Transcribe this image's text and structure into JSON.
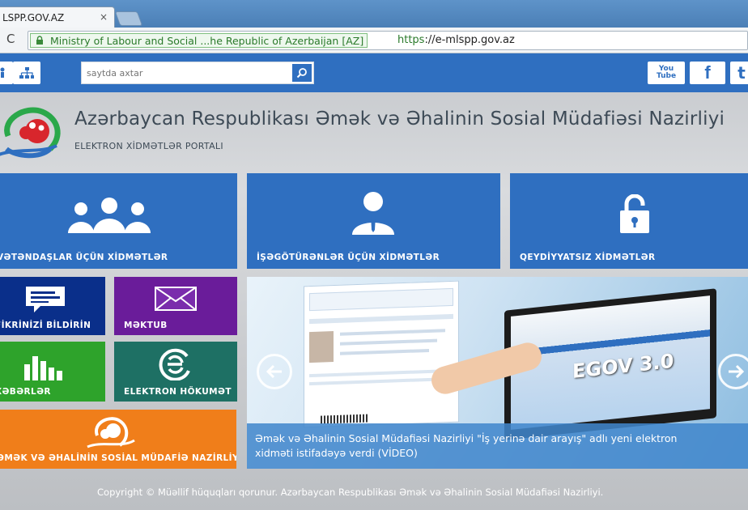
{
  "browser": {
    "tab_title": "LSPP.GOV.AZ",
    "tab_close": "×",
    "reload_icon": "C",
    "ev_label": "Ministry of Labour and Social ...he Republic of Azerbaijan [AZ]",
    "url_scheme": "https",
    "url_rest": "://e-mlspp.gov.az"
  },
  "topbar": {
    "search_placeholder": "saytda axtar",
    "social": [
      "You Tube",
      "f",
      "t"
    ]
  },
  "header": {
    "title": "Azərbaycan Respublikası Əmək və Əhalinin Sosial Müdafiəsi Nazirliyi",
    "subtitle": "ELEKTRON XİDMƏTLƏR PORTALI"
  },
  "tiles": {
    "citizens": "VƏTƏNDAŞLAR ÜÇÜN XİDMƏTLƏR",
    "employers": "İŞƏGÖTÜRƏNLƏR ÜÇÜN XİDMƏTLƏR",
    "unregistered": "QEYDİYYATSIZ XİDMƏTLƏR",
    "feedback": "FİKRİNİZİ BİLDİRİN",
    "letter": "MƏKTUB",
    "news": "XƏBƏRLƏR",
    "egov": "ELEKTRON HÖKUMƏT",
    "ministry": "ƏMƏK VƏ ƏHALİNİN SOSİAL MÜDAFİƏ NAZİRLİYİ"
  },
  "slider": {
    "egov_text": "EGOV 3.0",
    "caption_line1": "Əmək və Əhalinin Sosial Müdafiəsi Nazirliyi \"İş yerinə dair arayış\" adlı yeni elektron",
    "caption_line2": "xidməti istifadəyə verdi (VİDEO)"
  },
  "footer": {
    "copyright": "Copyright © Müəllif hüquqları qorunur. Azərbaycan Respublikası Əmək və Əhalinin Sosial Müdafiəsi Nazirliyi."
  },
  "colors": {
    "blue": "#2f6fc0",
    "navy": "#0a2f8a",
    "purple": "#6a1c9a",
    "green": "#2ea32b",
    "teal": "#1e7064",
    "orange": "#f07e1a"
  }
}
